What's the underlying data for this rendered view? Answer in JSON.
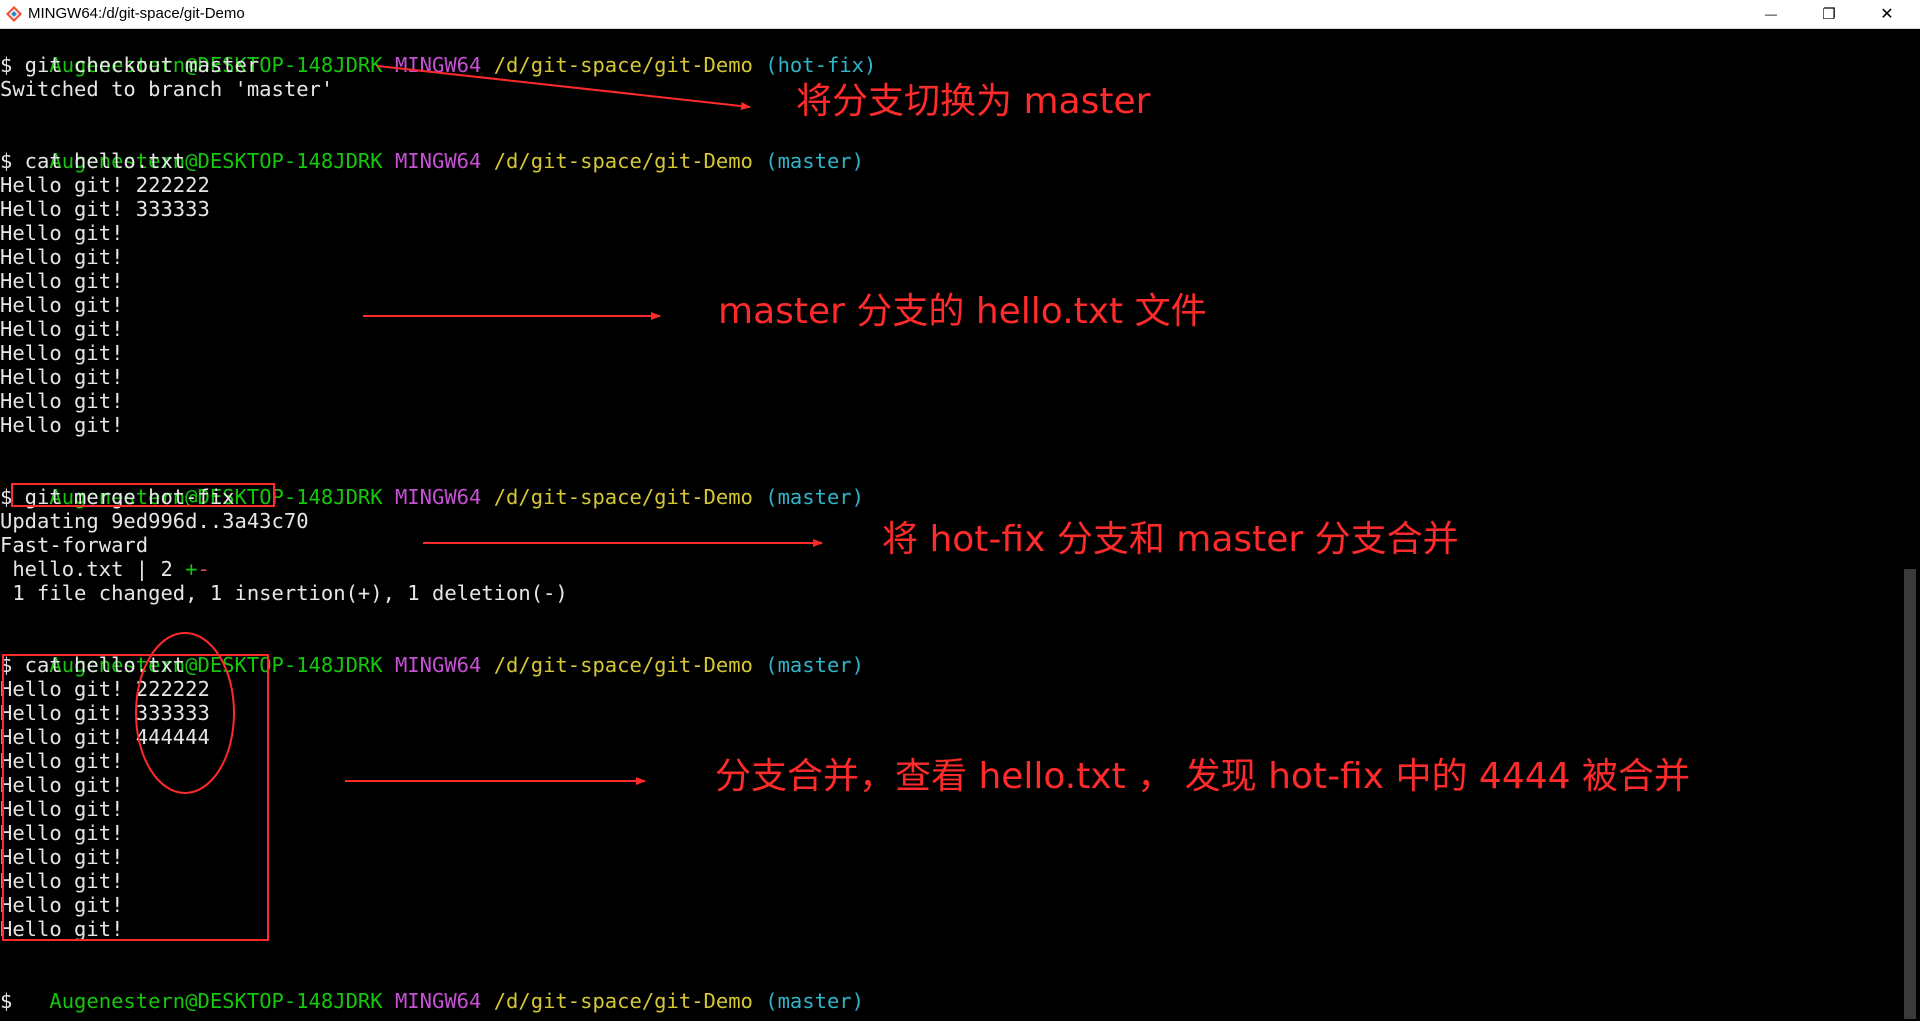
{
  "window": {
    "title": "MINGW64:/d/git-space/git-Demo",
    "minimize_glyph": "—",
    "restore_glyph": "❐",
    "close_glyph": "✕"
  },
  "prompt": {
    "user": "Augenestern@DESKTOP-148JDRK",
    "system": "MINGW64",
    "path": "/d/git-space/git-Demo"
  },
  "terminal": {
    "branch_1": "(hot-fix)",
    "branch_2": "(master)",
    "cmd_1": "$ git checkout master",
    "out_1": "Switched to branch 'master'",
    "cmd_2": "$ cat hello.txt",
    "out_2": [
      "Hello git! 222222",
      "Hello git! 333333",
      "Hello git!",
      "Hello git!",
      "Hello git!",
      "Hello git!",
      "Hello git!",
      "Hello git!",
      "Hello git!",
      "Hello git!",
      "Hello git!"
    ],
    "cmd_3": "$ git merge hot-fix",
    "out_3": [
      "Updating 9ed996d..3a43c70",
      "Fast-forward"
    ],
    "diffstat_prefix": " hello.txt | 2 ",
    "diffstat_plus": "+",
    "diffstat_minus": "-",
    "summary": " 1 file changed, 1 insertion(+), 1 deletion(-)",
    "cmd_4": "$ cat hello.txt",
    "out_4": [
      "Hello git! 222222",
      "Hello git! 333333",
      "Hello git! 444444",
      "Hello git!",
      "Hello git!",
      "Hello git!",
      "Hello git!",
      "Hello git!",
      "Hello git!",
      "Hello git!",
      "Hello git!"
    ],
    "cursor_prompt": "$"
  },
  "annotations": {
    "color": "#ff2a2a",
    "a1": "将分支切换为 master",
    "a2": "master 分支的 hello.txt 文件",
    "a3": "将 hot-fix 分支和 master 分支合并",
    "a4": "分支合并，查看 hello.txt ， 发现 hot-fix 中的 4444 被合并"
  },
  "colors": {
    "user": "#16c60c",
    "system": "#c74fd6",
    "path": "#d6c733",
    "branch": "#2fb5c9",
    "text": "#e6e6e6",
    "background": "#000000"
  }
}
